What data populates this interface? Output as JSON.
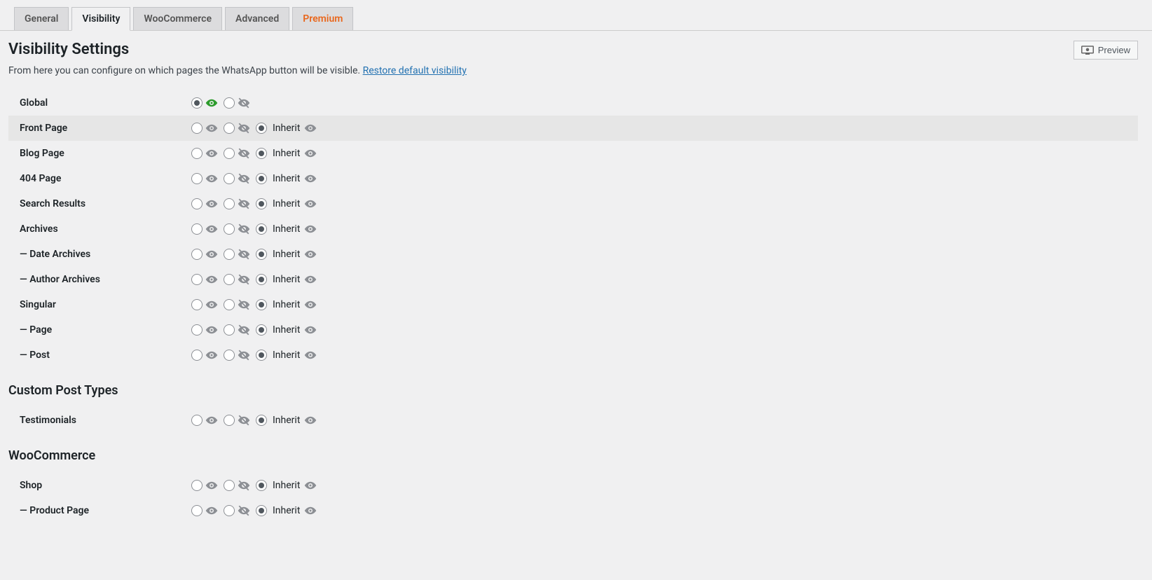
{
  "tabs": {
    "general": "General",
    "visibility": "Visibility",
    "woocommerce": "WooCommerce",
    "advanced": "Advanced",
    "premium": "Premium"
  },
  "title": "Visibility Settings",
  "desc_text": "From here you can configure on which pages the WhatsApp button will be visible. ",
  "restore_link": "Restore default visibility",
  "preview_label": "Preview",
  "inherit_label": "Inherit",
  "global_label": "Global",
  "rows": {
    "front_page": "Front Page",
    "blog_page": "Blog Page",
    "page_404": "404 Page",
    "search_results": "Search Results",
    "archives": "Archives",
    "date_archives": "— Date Archives",
    "author_archives": "— Author Archives",
    "singular": "Singular",
    "page": "— Page",
    "post": "— Post",
    "testimonials": "Testimonials",
    "shop": "Shop",
    "product_page": "— Product Page"
  },
  "sections": {
    "custom_post_types": "Custom Post Types",
    "woocommerce": "WooCommerce"
  }
}
